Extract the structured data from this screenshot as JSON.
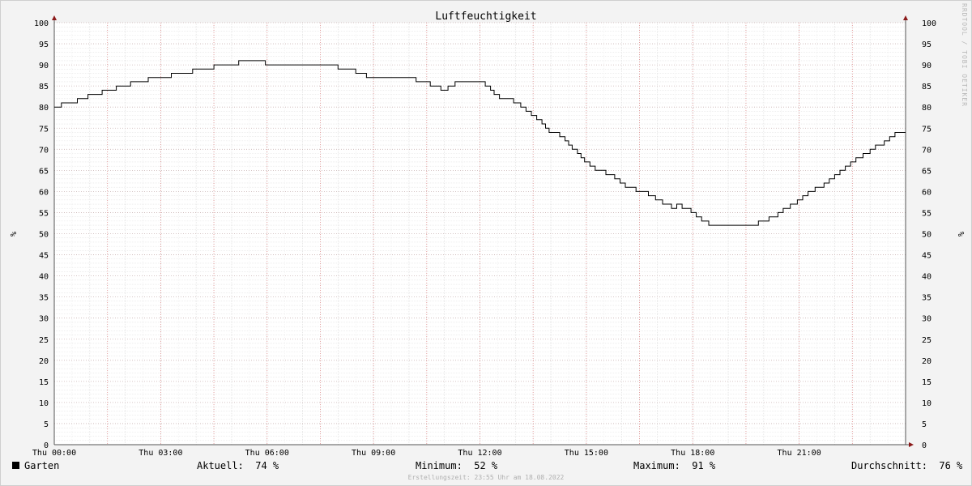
{
  "chart_data": {
    "type": "line",
    "title": "Luftfeuchtigkeit",
    "ylabel": "%",
    "ylim": [
      0,
      100
    ],
    "y_ticks": [
      0,
      5,
      10,
      15,
      20,
      25,
      30,
      35,
      40,
      45,
      50,
      55,
      60,
      65,
      70,
      75,
      80,
      85,
      90,
      95,
      100
    ],
    "x_range_hours": [
      0,
      24
    ],
    "x_ticks": [
      {
        "h": 0,
        "label": "Thu 00:00"
      },
      {
        "h": 3,
        "label": "Thu 03:00"
      },
      {
        "h": 6,
        "label": "Thu 06:00"
      },
      {
        "h": 9,
        "label": "Thu 09:00"
      },
      {
        "h": 12,
        "label": "Thu 12:00"
      },
      {
        "h": 15,
        "label": "Thu 15:00"
      },
      {
        "h": 18,
        "label": "Thu 18:00"
      },
      {
        "h": 21,
        "label": "Thu 21:00"
      }
    ],
    "grid": true,
    "series": [
      {
        "name": "Garten",
        "color": "#000000",
        "points": [
          [
            0.0,
            80
          ],
          [
            0.2,
            81
          ],
          [
            0.65,
            82
          ],
          [
            0.95,
            83
          ],
          [
            1.35,
            84
          ],
          [
            1.75,
            85
          ],
          [
            2.15,
            86
          ],
          [
            2.65,
            87
          ],
          [
            3.3,
            88
          ],
          [
            3.9,
            89
          ],
          [
            4.5,
            90
          ],
          [
            5.2,
            91
          ],
          [
            5.95,
            90
          ],
          [
            8.0,
            89
          ],
          [
            8.5,
            88
          ],
          [
            8.8,
            87
          ],
          [
            10.2,
            86
          ],
          [
            10.6,
            85
          ],
          [
            10.9,
            84
          ],
          [
            11.1,
            85
          ],
          [
            11.3,
            86
          ],
          [
            12.15,
            85
          ],
          [
            12.3,
            84
          ],
          [
            12.4,
            83
          ],
          [
            12.55,
            82
          ],
          [
            12.95,
            81
          ],
          [
            13.15,
            80
          ],
          [
            13.3,
            79
          ],
          [
            13.45,
            78
          ],
          [
            13.6,
            77
          ],
          [
            13.75,
            76
          ],
          [
            13.85,
            75
          ],
          [
            13.95,
            74
          ],
          [
            14.25,
            73
          ],
          [
            14.4,
            72
          ],
          [
            14.5,
            71
          ],
          [
            14.6,
            70
          ],
          [
            14.75,
            69
          ],
          [
            14.85,
            68
          ],
          [
            14.95,
            67
          ],
          [
            15.1,
            66
          ],
          [
            15.25,
            65
          ],
          [
            15.55,
            64
          ],
          [
            15.8,
            63
          ],
          [
            15.95,
            62
          ],
          [
            16.1,
            61
          ],
          [
            16.4,
            60
          ],
          [
            16.75,
            59
          ],
          [
            16.95,
            58
          ],
          [
            17.15,
            57
          ],
          [
            17.4,
            56
          ],
          [
            17.55,
            57
          ],
          [
            17.7,
            56
          ],
          [
            17.95,
            55
          ],
          [
            18.1,
            54
          ],
          [
            18.25,
            53
          ],
          [
            18.45,
            52
          ],
          [
            19.85,
            53
          ],
          [
            20.15,
            54
          ],
          [
            20.4,
            55
          ],
          [
            20.55,
            56
          ],
          [
            20.75,
            57
          ],
          [
            20.95,
            58
          ],
          [
            21.1,
            59
          ],
          [
            21.25,
            60
          ],
          [
            21.45,
            61
          ],
          [
            21.7,
            62
          ],
          [
            21.85,
            63
          ],
          [
            22.0,
            64
          ],
          [
            22.15,
            65
          ],
          [
            22.3,
            66
          ],
          [
            22.45,
            67
          ],
          [
            22.6,
            68
          ],
          [
            22.8,
            69
          ],
          [
            23.0,
            70
          ],
          [
            23.15,
            71
          ],
          [
            23.4,
            72
          ],
          [
            23.55,
            73
          ],
          [
            23.7,
            74
          ],
          [
            24.0,
            74
          ]
        ]
      }
    ]
  },
  "legend": {
    "series_name": "Garten",
    "current_label": "Aktuell:",
    "current_value": "74 %",
    "min_label": "Minimum:",
    "min_value": "52 %",
    "max_label": "Maximum:",
    "max_value": "91 %",
    "avg_label": "Durchschnitt:",
    "avg_value": "76 %"
  },
  "footer": "Erstellungszeit: 23:55 Uhr am 18.08.2022",
  "watermark": "RRDTOOL / TOBI OETIKER"
}
